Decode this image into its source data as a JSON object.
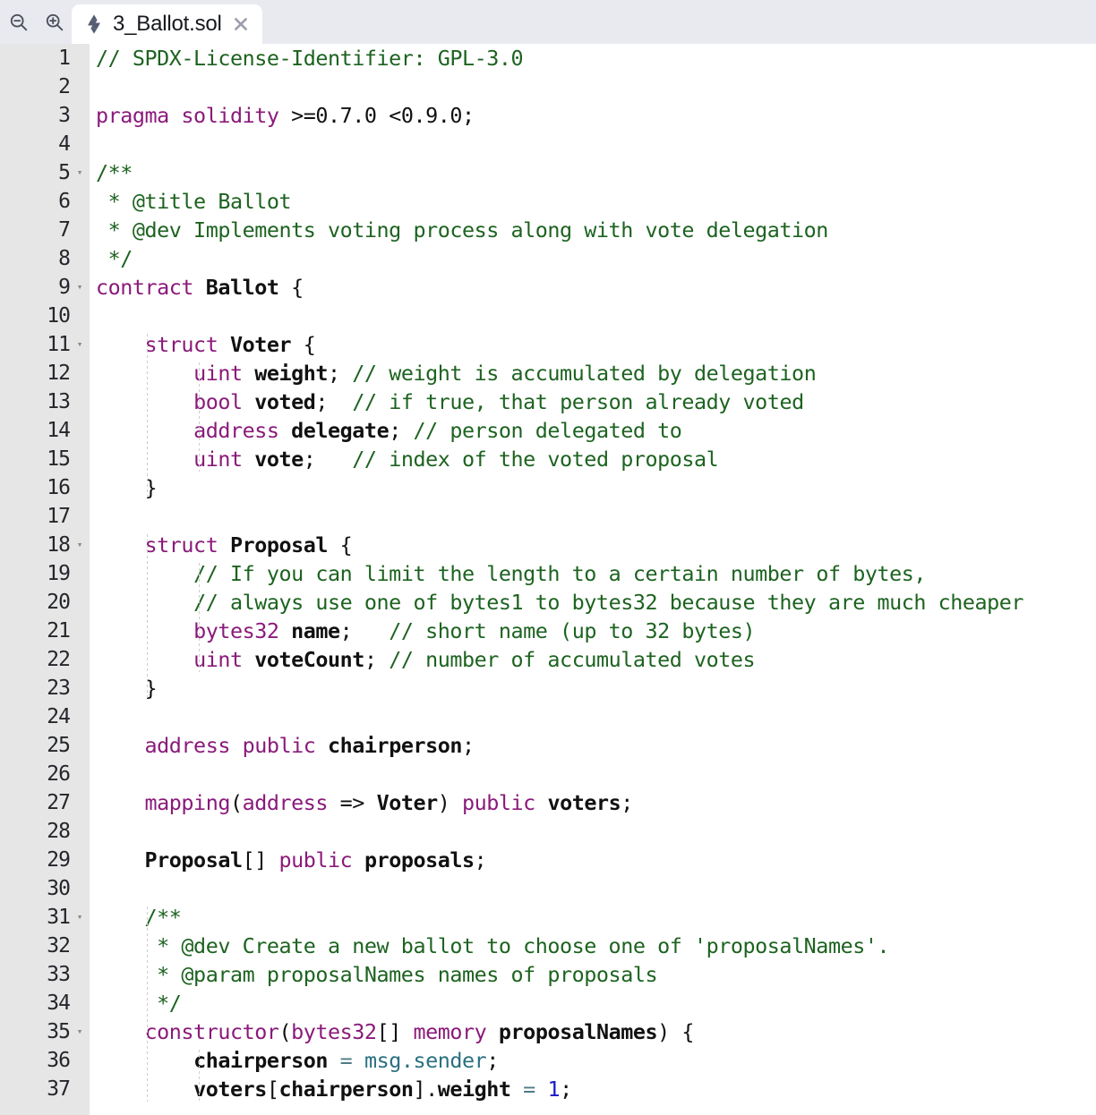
{
  "toolbar": {
    "zoom_out_icon": "zoom-out-icon",
    "zoom_in_icon": "zoom-in-icon"
  },
  "tab": {
    "file_icon": "solidity-logo-icon",
    "title": "3_Ballot.sol",
    "close_icon": "close-icon"
  },
  "editor": {
    "language": "solidity",
    "first_visible_line": 1,
    "last_visible_line": 37,
    "fold_marker": "▾",
    "fold_lines": [
      5,
      9,
      11,
      18,
      31,
      35
    ],
    "colors": {
      "comment": "#1d6320",
      "keyword": "#8a1a7a",
      "number": "#1a18c8",
      "builtin": "#2a7080",
      "plain": "#111111",
      "gutter_bg": "#e6e6e6",
      "editor_bg": "#ffffff",
      "tabbar_bg": "#e9eaf0"
    },
    "lines": [
      {
        "n": 1,
        "fold": false,
        "tokens": [
          {
            "t": "cm",
            "v": "// SPDX-License-Identifier: GPL-3.0"
          }
        ]
      },
      {
        "n": 2,
        "fold": false,
        "tokens": []
      },
      {
        "n": 3,
        "fold": false,
        "tokens": [
          {
            "t": "k",
            "v": "pragma solidity"
          },
          {
            "t": "pl",
            "v": " >=0.7.0 <0.9.0;"
          }
        ]
      },
      {
        "n": 4,
        "fold": false,
        "tokens": []
      },
      {
        "n": 5,
        "fold": true,
        "tokens": [
          {
            "t": "cm",
            "v": "/**"
          }
        ]
      },
      {
        "n": 6,
        "fold": false,
        "tokens": [
          {
            "t": "cm",
            "v": " * @title Ballot"
          }
        ]
      },
      {
        "n": 7,
        "fold": false,
        "tokens": [
          {
            "t": "cm",
            "v": " * @dev Implements voting process along with vote delegation"
          }
        ]
      },
      {
        "n": 8,
        "fold": false,
        "tokens": [
          {
            "t": "cm",
            "v": " */"
          }
        ]
      },
      {
        "n": 9,
        "fold": true,
        "tokens": [
          {
            "t": "k",
            "v": "contract"
          },
          {
            "t": "pl",
            "v": " "
          },
          {
            "t": "id",
            "v": "Ballot"
          },
          {
            "t": "pl",
            "v": " {"
          }
        ]
      },
      {
        "n": 10,
        "fold": false,
        "tokens": []
      },
      {
        "n": 11,
        "fold": true,
        "tokens": [
          {
            "t": "pl",
            "v": "    "
          },
          {
            "t": "k",
            "v": "struct"
          },
          {
            "t": "pl",
            "v": " "
          },
          {
            "t": "id",
            "v": "Voter"
          },
          {
            "t": "pl",
            "v": " {"
          }
        ]
      },
      {
        "n": 12,
        "fold": false,
        "tokens": [
          {
            "t": "pl",
            "v": "        "
          },
          {
            "t": "k",
            "v": "uint"
          },
          {
            "t": "pl",
            "v": " "
          },
          {
            "t": "id",
            "v": "weight"
          },
          {
            "t": "pl",
            "v": "; "
          },
          {
            "t": "cm",
            "v": "// weight is accumulated by delegation"
          }
        ]
      },
      {
        "n": 13,
        "fold": false,
        "tokens": [
          {
            "t": "pl",
            "v": "        "
          },
          {
            "t": "k",
            "v": "bool"
          },
          {
            "t": "pl",
            "v": " "
          },
          {
            "t": "id",
            "v": "voted"
          },
          {
            "t": "pl",
            "v": ";  "
          },
          {
            "t": "cm",
            "v": "// if true, that person already voted"
          }
        ]
      },
      {
        "n": 14,
        "fold": false,
        "tokens": [
          {
            "t": "pl",
            "v": "        "
          },
          {
            "t": "k",
            "v": "address"
          },
          {
            "t": "pl",
            "v": " "
          },
          {
            "t": "id",
            "v": "delegate"
          },
          {
            "t": "pl",
            "v": "; "
          },
          {
            "t": "cm",
            "v": "// person delegated to"
          }
        ]
      },
      {
        "n": 15,
        "fold": false,
        "tokens": [
          {
            "t": "pl",
            "v": "        "
          },
          {
            "t": "k",
            "v": "uint"
          },
          {
            "t": "pl",
            "v": " "
          },
          {
            "t": "id",
            "v": "vote"
          },
          {
            "t": "pl",
            "v": ";   "
          },
          {
            "t": "cm",
            "v": "// index of the voted proposal"
          }
        ]
      },
      {
        "n": 16,
        "fold": false,
        "tokens": [
          {
            "t": "pl",
            "v": "    }"
          }
        ]
      },
      {
        "n": 17,
        "fold": false,
        "tokens": []
      },
      {
        "n": 18,
        "fold": true,
        "tokens": [
          {
            "t": "pl",
            "v": "    "
          },
          {
            "t": "k",
            "v": "struct"
          },
          {
            "t": "pl",
            "v": " "
          },
          {
            "t": "id",
            "v": "Proposal"
          },
          {
            "t": "pl",
            "v": " {"
          }
        ]
      },
      {
        "n": 19,
        "fold": false,
        "tokens": [
          {
            "t": "pl",
            "v": "        "
          },
          {
            "t": "cm",
            "v": "// If you can limit the length to a certain number of bytes,"
          }
        ]
      },
      {
        "n": 20,
        "fold": false,
        "tokens": [
          {
            "t": "pl",
            "v": "        "
          },
          {
            "t": "cm",
            "v": "// always use one of bytes1 to bytes32 because they are much cheaper"
          }
        ]
      },
      {
        "n": 21,
        "fold": false,
        "tokens": [
          {
            "t": "pl",
            "v": "        "
          },
          {
            "t": "k",
            "v": "bytes32"
          },
          {
            "t": "pl",
            "v": " "
          },
          {
            "t": "id",
            "v": "name"
          },
          {
            "t": "pl",
            "v": ";   "
          },
          {
            "t": "cm",
            "v": "// short name (up to 32 bytes)"
          }
        ]
      },
      {
        "n": 22,
        "fold": false,
        "tokens": [
          {
            "t": "pl",
            "v": "        "
          },
          {
            "t": "k",
            "v": "uint"
          },
          {
            "t": "pl",
            "v": " "
          },
          {
            "t": "id",
            "v": "voteCount"
          },
          {
            "t": "pl",
            "v": "; "
          },
          {
            "t": "cm",
            "v": "// number of accumulated votes"
          }
        ]
      },
      {
        "n": 23,
        "fold": false,
        "tokens": [
          {
            "t": "pl",
            "v": "    }"
          }
        ]
      },
      {
        "n": 24,
        "fold": false,
        "tokens": []
      },
      {
        "n": 25,
        "fold": false,
        "tokens": [
          {
            "t": "pl",
            "v": "    "
          },
          {
            "t": "k",
            "v": "address public"
          },
          {
            "t": "pl",
            "v": " "
          },
          {
            "t": "id",
            "v": "chairperson"
          },
          {
            "t": "pl",
            "v": ";"
          }
        ]
      },
      {
        "n": 26,
        "fold": false,
        "tokens": []
      },
      {
        "n": 27,
        "fold": false,
        "tokens": [
          {
            "t": "pl",
            "v": "    "
          },
          {
            "t": "k",
            "v": "mapping"
          },
          {
            "t": "pl",
            "v": "("
          },
          {
            "t": "k",
            "v": "address"
          },
          {
            "t": "pl",
            "v": " => "
          },
          {
            "t": "id",
            "v": "Voter"
          },
          {
            "t": "pl",
            "v": ") "
          },
          {
            "t": "k",
            "v": "public"
          },
          {
            "t": "pl",
            "v": " "
          },
          {
            "t": "id",
            "v": "voters"
          },
          {
            "t": "pl",
            "v": ";"
          }
        ]
      },
      {
        "n": 28,
        "fold": false,
        "tokens": []
      },
      {
        "n": 29,
        "fold": false,
        "tokens": [
          {
            "t": "pl",
            "v": "    "
          },
          {
            "t": "id",
            "v": "Proposal"
          },
          {
            "t": "pl",
            "v": "[] "
          },
          {
            "t": "k",
            "v": "public"
          },
          {
            "t": "pl",
            "v": " "
          },
          {
            "t": "id",
            "v": "proposals"
          },
          {
            "t": "pl",
            "v": ";"
          }
        ]
      },
      {
        "n": 30,
        "fold": false,
        "tokens": []
      },
      {
        "n": 31,
        "fold": true,
        "tokens": [
          {
            "t": "pl",
            "v": "    "
          },
          {
            "t": "cm",
            "v": "/**"
          }
        ]
      },
      {
        "n": 32,
        "fold": false,
        "tokens": [
          {
            "t": "pl",
            "v": "    "
          },
          {
            "t": "cm",
            "v": " * @dev Create a new ballot to choose one of 'proposalNames'."
          }
        ]
      },
      {
        "n": 33,
        "fold": false,
        "tokens": [
          {
            "t": "pl",
            "v": "    "
          },
          {
            "t": "cm",
            "v": " * @param proposalNames names of proposals"
          }
        ]
      },
      {
        "n": 34,
        "fold": false,
        "tokens": [
          {
            "t": "pl",
            "v": "    "
          },
          {
            "t": "cm",
            "v": " */"
          }
        ]
      },
      {
        "n": 35,
        "fold": true,
        "tokens": [
          {
            "t": "pl",
            "v": "    "
          },
          {
            "t": "k",
            "v": "constructor"
          },
          {
            "t": "pl",
            "v": "("
          },
          {
            "t": "k",
            "v": "bytes32"
          },
          {
            "t": "pl",
            "v": "[] "
          },
          {
            "t": "k",
            "v": "memory"
          },
          {
            "t": "pl",
            "v": " "
          },
          {
            "t": "id",
            "v": "proposalNames"
          },
          {
            "t": "pl",
            "v": ") {"
          }
        ]
      },
      {
        "n": 36,
        "fold": false,
        "tokens": [
          {
            "t": "pl",
            "v": "        "
          },
          {
            "t": "id",
            "v": "chairperson"
          },
          {
            "t": "pl",
            "v": " "
          },
          {
            "t": "op",
            "v": "="
          },
          {
            "t": "pl",
            "v": " "
          },
          {
            "t": "bi",
            "v": "msg.sender"
          },
          {
            "t": "pl",
            "v": ";"
          }
        ]
      },
      {
        "n": 37,
        "fold": false,
        "tokens": [
          {
            "t": "pl",
            "v": "        "
          },
          {
            "t": "id",
            "v": "voters"
          },
          {
            "t": "pl",
            "v": "["
          },
          {
            "t": "id",
            "v": "chairperson"
          },
          {
            "t": "pl",
            "v": "]."
          },
          {
            "t": "id",
            "v": "weight"
          },
          {
            "t": "pl",
            "v": " "
          },
          {
            "t": "op",
            "v": "="
          },
          {
            "t": "pl",
            "v": " "
          },
          {
            "t": "num",
            "v": "1"
          },
          {
            "t": "pl",
            "v": ";"
          }
        ]
      }
    ],
    "indent_guides": [
      {
        "indent": 1,
        "from_line": 11,
        "to_line": 16
      },
      {
        "indent": 1,
        "from_line": 18,
        "to_line": 23
      },
      {
        "indent": 1,
        "from_line": 31,
        "to_line": 37
      },
      {
        "indent": 2,
        "from_line": 12,
        "to_line": 15
      },
      {
        "indent": 2,
        "from_line": 19,
        "to_line": 22
      },
      {
        "indent": 2,
        "from_line": 36,
        "to_line": 37
      }
    ]
  }
}
